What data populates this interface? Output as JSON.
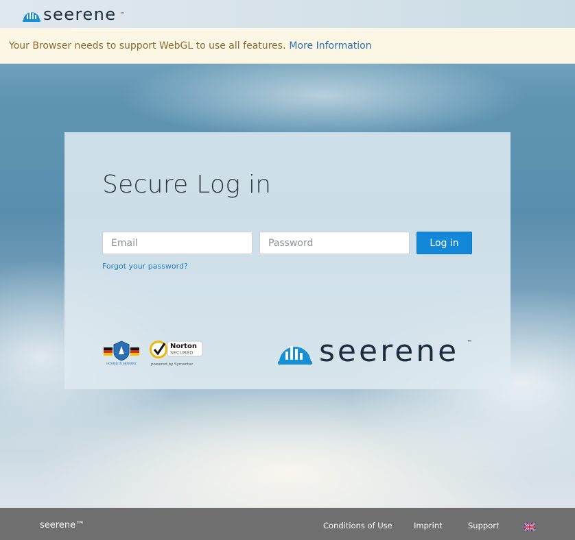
{
  "header": {
    "brand": "seerene",
    "trademark": "™"
  },
  "warning": {
    "message": "Your Browser needs to support WebGL to use all features.",
    "link": "More Information"
  },
  "login": {
    "title": "Secure Log in",
    "email_placeholder": "Email",
    "password_placeholder": "Password",
    "submit_label": "Log in",
    "forgot_link": "Forgot your password?",
    "badges": {
      "germany": "HOSTED IN GERMANY",
      "norton_title": "Norton",
      "norton_sub": "SECURED",
      "norton_powered": "powered by Symantec"
    },
    "brand": "seerene",
    "trademark": "™"
  },
  "footer": {
    "copyright": "seerene™",
    "links": [
      "Conditions of Use",
      "Imprint",
      "Support"
    ],
    "language_icon": "uk-flag-icon"
  },
  "colors": {
    "brand_blue": "#1590d4",
    "login_button": "#1488d8",
    "footer_bg": "#6f6f6f",
    "warning_bg": "#fcf7e5"
  }
}
